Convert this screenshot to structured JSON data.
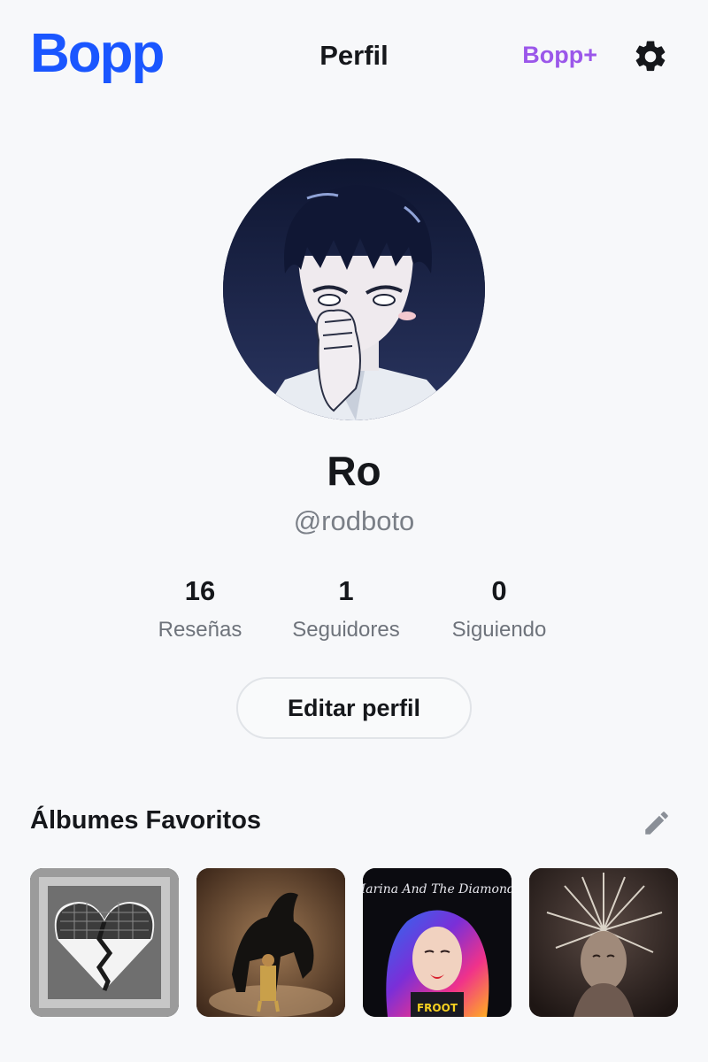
{
  "header": {
    "logo": "Bopp",
    "title": "Perfil",
    "premium_label": "Bopp+",
    "brand_color": "#1a56ff",
    "premium_color": "#9b57ea",
    "settings_icon": "gear-icon"
  },
  "profile": {
    "display_name": "Ro",
    "username": "@rodboto",
    "avatar": "anime-character-avatar"
  },
  "stats": [
    {
      "value": "16",
      "label": "Reseñas"
    },
    {
      "value": "1",
      "label": "Seguidores"
    },
    {
      "value": "0",
      "label": "Siguiendo"
    }
  ],
  "edit_profile_label": "Editar perfil",
  "favorites": {
    "title": "Álbumes Favoritos",
    "edit_icon": "pencil-icon",
    "albums": [
      {
        "cover": "broken-heart-mirror-cover"
      },
      {
        "cover": "horse-rider-cover"
      },
      {
        "cover": "marina-froot-cover",
        "cover_text": "Marina And The Diamonds",
        "cover_subtext": "FROOT"
      },
      {
        "cover": "feather-headdress-cover"
      }
    ]
  }
}
